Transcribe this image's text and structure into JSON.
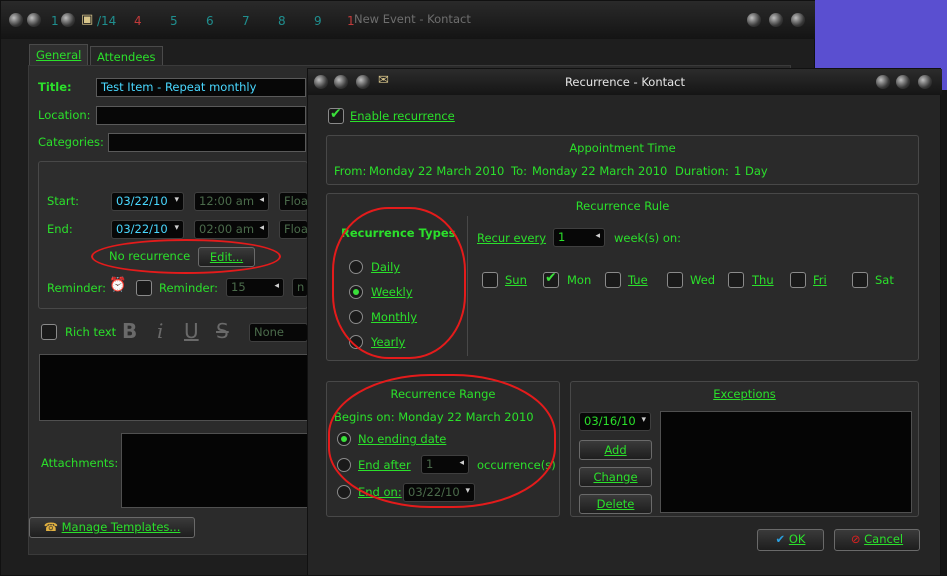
{
  "background_window": {
    "title": "New Event - Kontact",
    "strip_numbers": [
      "1",
      "/14",
      "4",
      "5",
      "6",
      "7",
      "8",
      "9",
      "1"
    ],
    "tabs": [
      "General",
      "Attendees"
    ],
    "title_label": "Title:",
    "title_value": "Test Item - Repeat monthly",
    "location_label": "Location:",
    "categories_label": "Categories:",
    "start_label": "Start:",
    "start_date": "03/22/10",
    "start_time": "12:00 am",
    "end_label": "End:",
    "end_date": "03/22/10",
    "end_time": "02:00 am",
    "float_partial": "Floa",
    "no_recurrence": "No recurrence",
    "edit_button": "Edit...",
    "reminder_label": "Reminder:",
    "reminder_checkbox_label": "Reminder:",
    "reminder_value": "15",
    "reminder_unit_partial": "n",
    "rich_text_label": "Rich text",
    "format_buttons": [
      "B",
      "i",
      "U",
      "S"
    ],
    "font_combo": "None",
    "attachments_label": "Attachments:",
    "manage_templates": "Manage Templates..."
  },
  "dialog": {
    "title": "Recurrence - Kontact",
    "enable_recurrence": "Enable recurrence",
    "appointment_time": {
      "title": "Appointment Time",
      "from_label": "From:",
      "from_value": "Monday 22 March 2010",
      "to_label": "To:",
      "to_value": "Monday 22 March 2010",
      "duration_label": "Duration:",
      "duration_value": "1 Day"
    },
    "recurrence_rule": {
      "title": "Recurrence Rule",
      "types_title": "Recurrence Types",
      "types": [
        "Daily",
        "Weekly",
        "Monthly",
        "Yearly"
      ],
      "selected_type": "Weekly",
      "recur_every_label": "Recur every",
      "recur_every_value": "1",
      "recur_unit": "week(s) on:",
      "days": [
        "Sun",
        "Mon",
        "Tue",
        "Wed",
        "Thu",
        "Fri",
        "Sat"
      ],
      "checked_days": [
        "Mon"
      ]
    },
    "recurrence_range": {
      "title": "Recurrence Range",
      "begins_on": "Begins on: Monday 22 March 2010",
      "no_ending": "No ending date",
      "end_after": "End after",
      "end_after_value": "1",
      "occurrences": "occurrence(s)",
      "end_on": "End on:",
      "end_on_value": "03/22/10"
    },
    "exceptions": {
      "title": "Exceptions",
      "date": "03/16/10",
      "add": "Add",
      "change": "Change",
      "delete": "Delete"
    },
    "ok": "OK",
    "cancel": "Cancel"
  },
  "colors": {
    "text_green": "#2be02b",
    "field_cyan": "#49d8ff",
    "annotation_red": "#e41b1b",
    "desktop": "#5a4fd0"
  }
}
